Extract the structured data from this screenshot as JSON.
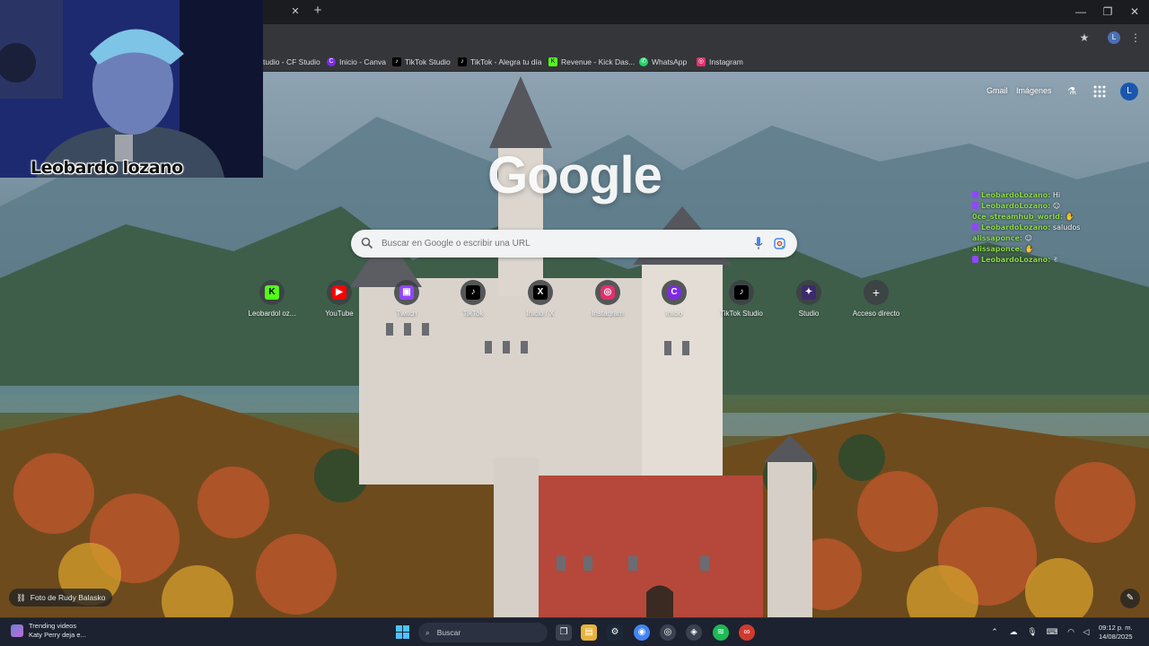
{
  "bookmarks": [
    {
      "label": "tudio - CF Studio",
      "color": "#3a3b3e",
      "glyph": ""
    },
    {
      "label": "Inicio - Canva",
      "color": "#7d2ae8",
      "glyph": "C"
    },
    {
      "label": "TikTok Studio",
      "color": "#000000",
      "glyph": "♪"
    },
    {
      "label": "TikTok - Alegra tu día",
      "color": "#000000",
      "glyph": "♪"
    },
    {
      "label": "Revenue - Kick Das...",
      "color": "#53fc18",
      "glyph": "K"
    },
    {
      "label": "WhatsApp",
      "color": "#25d366",
      "glyph": "✆"
    },
    {
      "label": "Instagram",
      "color": "#e1306c",
      "glyph": "◎"
    }
  ],
  "profile_initial": "L",
  "webcam": {
    "name": "Leobardo lozano"
  },
  "header_links": {
    "gmail": "Gmail",
    "images": "Imágenes"
  },
  "logo": "Google",
  "search": {
    "placeholder": "Buscar en Google o escribir una URL"
  },
  "shortcuts": [
    {
      "label": "Leobardol oz...",
      "glyph": "K",
      "color": "#53fc18",
      "text_color": "#000000"
    },
    {
      "label": "YouTube",
      "glyph": "▶",
      "color": "#ff0000",
      "text_color": "#ffffff"
    },
    {
      "label": "Twitch",
      "glyph": "▣",
      "color": "#9146ff",
      "text_color": "#ffffff"
    },
    {
      "label": "TikTok",
      "glyph": "♪",
      "color": "#000000",
      "text_color": "#ffffff"
    },
    {
      "label": "Inicio / X",
      "glyph": "X",
      "color": "#000000",
      "text_color": "#ffffff"
    },
    {
      "label": "Instagram",
      "glyph": "◎",
      "color": "#e1306c",
      "text_color": "#ffffff"
    },
    {
      "label": "Inicio",
      "glyph": "C",
      "color": "#7d2ae8",
      "text_color": "#ffffff"
    },
    {
      "label": "TikTok Studio",
      "glyph": "♪",
      "color": "#000000",
      "text_color": "#ffffff"
    },
    {
      "label": "Studio",
      "glyph": "✦",
      "color": "#3c2a6b",
      "text_color": "#ffffff"
    },
    {
      "label": "Acceso directo",
      "glyph": "+",
      "color": "transparent",
      "text_color": "#ffffff"
    }
  ],
  "chat": [
    {
      "user": "LeobardoLozano:",
      "message": "Hi",
      "badge": true
    },
    {
      "user": "LeobardoLozano:",
      "message": "☺",
      "badge": true
    },
    {
      "user": "0ce_streamhub_world:",
      "message": "✋",
      "badge": false
    },
    {
      "user": "LeobardoLozano:",
      "message": "saludos",
      "badge": true
    },
    {
      "user": "alissaponce:",
      "message": "☺",
      "badge": false
    },
    {
      "user": "alissaponce:",
      "message": "✋",
      "badge": false
    },
    {
      "user": "LeobardoLozano:",
      "message": "✌",
      "badge": true
    }
  ],
  "credit": "Foto de Rudy Balasko",
  "taskbar": {
    "widget_title": "Trending videos",
    "widget_subtitle": "Katy Perry deja e...",
    "search_label": "Buscar",
    "time": "09:12 p. m.",
    "date": "14/08/2025"
  }
}
